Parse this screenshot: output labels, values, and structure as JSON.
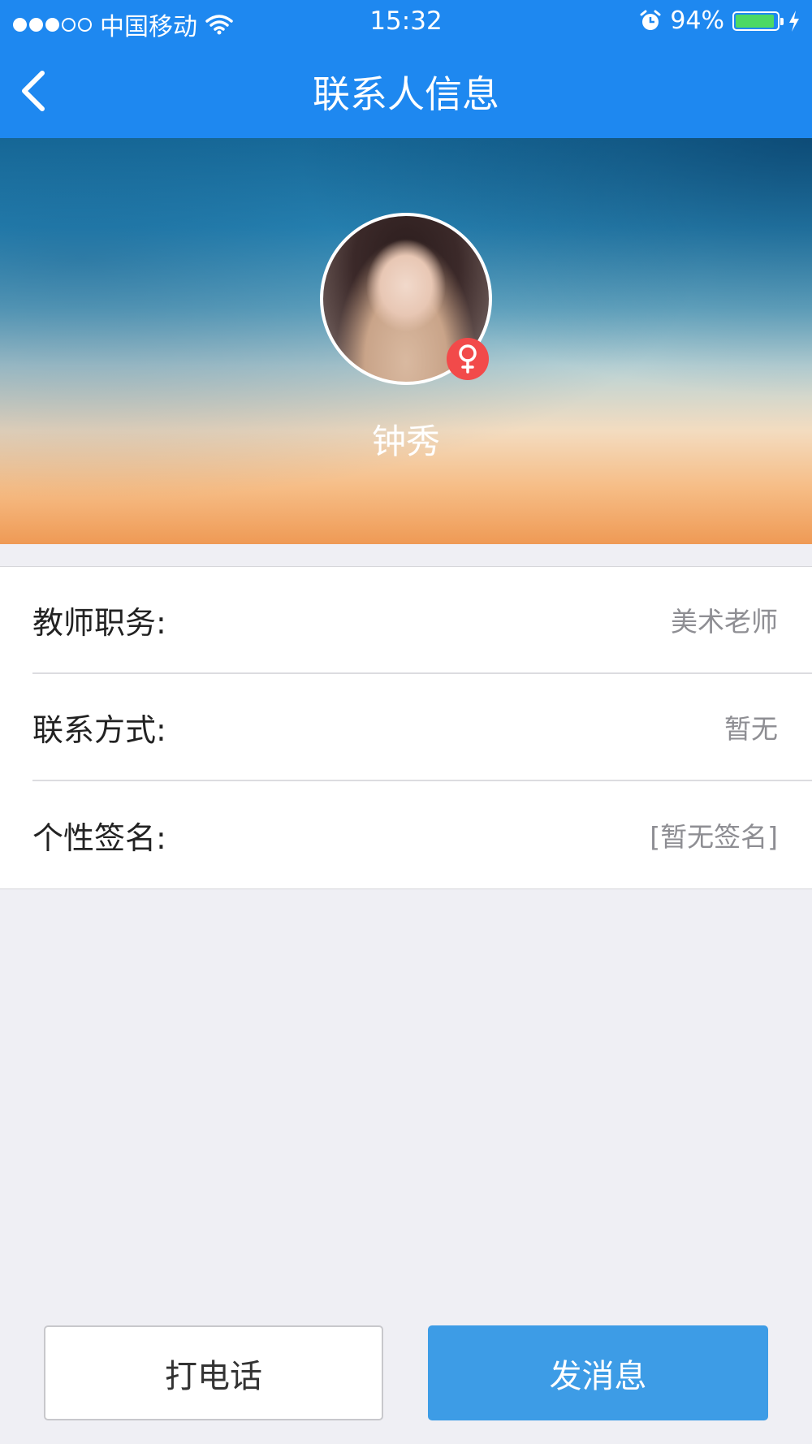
{
  "status_bar": {
    "signal_filled": 3,
    "signal_total": 5,
    "carrier": "中国移动",
    "time": "15:32",
    "battery_percent_label": "94%",
    "battery_level": 0.94,
    "icons": [
      "wifi-icon",
      "alarm-icon",
      "battery-icon",
      "charging-icon"
    ]
  },
  "nav": {
    "title": "联系人信息",
    "back_icon": "chevron-left-icon"
  },
  "profile": {
    "name": "钟秀",
    "gender_icon": "female-symbol-icon",
    "badge_color": "#f24a4a"
  },
  "info": {
    "rows": [
      {
        "label": "教师职务:",
        "value": "美术老师"
      },
      {
        "label": "联系方式:",
        "value": "暂无"
      },
      {
        "label": "个性签名:",
        "value": "[暂无签名]"
      }
    ]
  },
  "actions": {
    "call_label": "打电话",
    "message_label": "发消息"
  },
  "colors": {
    "primary": "#1e88f0",
    "button_blue": "#3d9ce6",
    "background": "#efeff4"
  }
}
